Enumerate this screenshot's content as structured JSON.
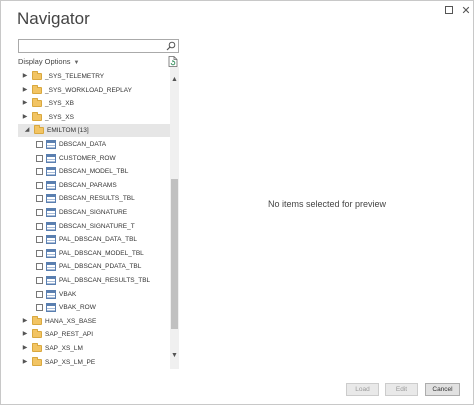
{
  "window": {
    "title": "Navigator",
    "maximize_icon": "maximize-icon",
    "close_glyph": "✕"
  },
  "search": {
    "value": "",
    "placeholder": "",
    "icon": "search-icon"
  },
  "display_options": {
    "label": "Display Options",
    "caret": "▼"
  },
  "tree": {
    "items": [
      {
        "label": "_SYS_TELEMETRY",
        "type": "folder",
        "expanded": false
      },
      {
        "label": "_SYS_WORKLOAD_REPLAY",
        "type": "folder",
        "expanded": false
      },
      {
        "label": "_SYS_XB",
        "type": "folder",
        "expanded": false
      },
      {
        "label": "_SYS_XS",
        "type": "folder",
        "expanded": false
      },
      {
        "label": "EMILTOM [13]",
        "type": "folder",
        "expanded": true,
        "selected": true
      },
      {
        "label": "DBSCAN_DATA",
        "type": "table"
      },
      {
        "label": "CUSTOMER_ROW",
        "type": "table"
      },
      {
        "label": "DBSCAN_MODEL_TBL",
        "type": "table"
      },
      {
        "label": "DBSCAN_PARAMS",
        "type": "table"
      },
      {
        "label": "DBSCAN_RESULTS_TBL",
        "type": "table"
      },
      {
        "label": "DBSCAN_SIGNATURE",
        "type": "table"
      },
      {
        "label": "DBSCAN_SIGNATURE_T",
        "type": "table"
      },
      {
        "label": "PAL_DBSCAN_DATA_TBL",
        "type": "table"
      },
      {
        "label": "PAL_DBSCAN_MODEL_TBL",
        "type": "table"
      },
      {
        "label": "PAL_DBSCAN_PDATA_TBL",
        "type": "table"
      },
      {
        "label": "PAL_DBSCAN_RESULTS_TBL",
        "type": "table"
      },
      {
        "label": "VBAK",
        "type": "table"
      },
      {
        "label": "VBAK_ROW",
        "type": "table"
      },
      {
        "label": "HANA_XS_BASE",
        "type": "folder",
        "expanded": false
      },
      {
        "label": "SAP_REST_API",
        "type": "folder",
        "expanded": false
      },
      {
        "label": "SAP_XS_LM",
        "type": "folder",
        "expanded": false
      },
      {
        "label": "SAP_XS_LM_PE",
        "type": "folder",
        "expanded": false
      }
    ]
  },
  "preview": {
    "message": "No items selected for preview"
  },
  "buttons": {
    "load": "Load",
    "edit": "Edit",
    "cancel": "Cancel"
  },
  "icons": {
    "expand_collapsed": "▶",
    "expand_open": "◢",
    "scroll_up": "▲",
    "scroll_down": "▼"
  },
  "colors": {
    "folder": "#f2c463",
    "table": "#5a7fb0",
    "selected_row": "#e6e6e6"
  }
}
